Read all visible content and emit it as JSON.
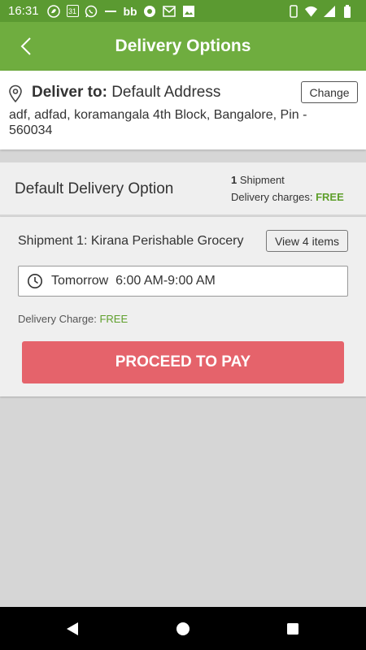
{
  "status_bar": {
    "time": "16:31",
    "notification_icons": [
      "leaf-icon",
      "calendar-icon",
      "whatsapp-icon",
      "dash-icon",
      "bb-icon",
      "chrome-icon",
      "gmail-icon",
      "gallery-icon"
    ],
    "calendar_day": "31",
    "bb_text": "bb",
    "system_icons": [
      "vibrate-icon",
      "wifi-icon",
      "signal-icon",
      "battery-icon"
    ]
  },
  "header": {
    "title": "Delivery Options"
  },
  "address": {
    "label": "Deliver to:",
    "name": "Default Address",
    "change_label": "Change",
    "text": "adf, adfad, koramangala 4th Block, Bangalore, Pin - 560034"
  },
  "summary": {
    "title": "Default Delivery Option",
    "shipment_count": "1",
    "shipment_label": "Shipment",
    "charges_label": "Delivery charges:",
    "charges_value": "FREE"
  },
  "shipment": {
    "title": "Shipment 1: Kirana Perishable Grocery",
    "view_label": "View 4 items",
    "slot_day": "Tomorrow",
    "slot_time": "6:00 AM-9:00 AM",
    "charge_label": "Delivery Charge:",
    "charge_value": "FREE"
  },
  "actions": {
    "proceed_label": "PROCEED TO PAY"
  },
  "colors": {
    "status_bar": "#5b9a31",
    "app_bar": "#6fad3f",
    "free_text": "#5e9f2b",
    "pay_button": "#e5636b",
    "background": "#d6d6d6"
  }
}
